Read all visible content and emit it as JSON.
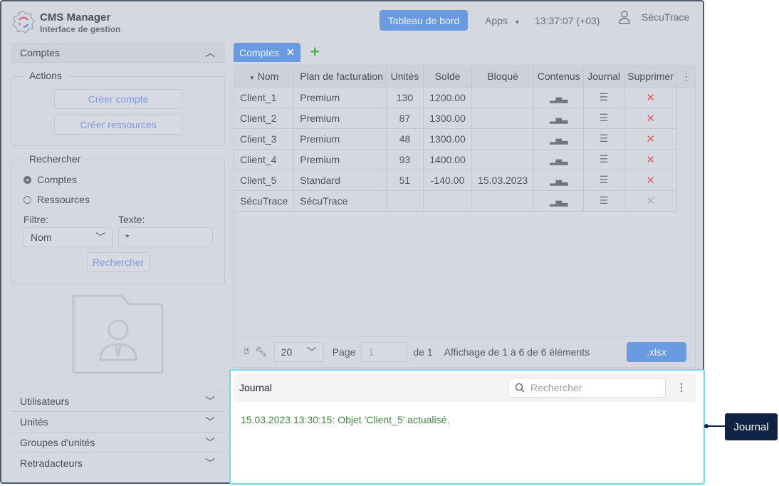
{
  "app": {
    "title": "CMS Manager",
    "subtitle": "Interface de gestion"
  },
  "header": {
    "dashboard": "Tableau de bord",
    "apps": "Apps",
    "time": "13:37:07 (+03)",
    "user": "SécuTrace"
  },
  "sidebar": {
    "section": "Comptes",
    "actions": {
      "legend": "Actions",
      "create_account": "Créer compte",
      "create_resources": "Créer ressources"
    },
    "search": {
      "legend": "Rechercher",
      "radio_accounts": "Comptes",
      "radio_resources": "Ressources",
      "filter_label": "Filtre:",
      "filter_value": "Nom",
      "text_label": "Texte:",
      "text_value": "*",
      "button": "Rechercher"
    },
    "accordion": [
      "Utilisateurs",
      "Unités",
      "Groupes d'unités",
      "Retradacteurs"
    ]
  },
  "tabs": [
    {
      "label": "Comptes"
    }
  ],
  "table": {
    "columns": [
      "Nom",
      "Plan de facturation",
      "Unités",
      "Solde",
      "Bloqué",
      "Contenus",
      "Journal",
      "Supprimer"
    ],
    "rows": [
      [
        "Client_1",
        "Premium",
        "130",
        "1200.00",
        ""
      ],
      [
        "Client_2",
        "Premium",
        "87",
        "1300.00",
        ""
      ],
      [
        "Client_3",
        "Premium",
        "48",
        "1300.00",
        ""
      ],
      [
        "Client_4",
        "Premium",
        "93",
        "1400.00",
        ""
      ],
      [
        "Client_5",
        "Standard",
        "51",
        "-140.00",
        "15.03.2023"
      ],
      [
        "SécuTrace",
        "SécuTrace",
        "",
        "",
        ""
      ]
    ]
  },
  "pager": {
    "page_size": "20",
    "page_label": "Page",
    "page_value": "1",
    "of": "de 1",
    "summary": "Affichage de 1 à 6 de 6 éléments",
    "export": ".xlsx"
  },
  "journal": {
    "title": "Journal",
    "search_placeholder": "Rechercher",
    "entries": [
      "15.03.2023 13:30:15: Objet 'Client_5' actualisé."
    ]
  },
  "callout": "Journal"
}
